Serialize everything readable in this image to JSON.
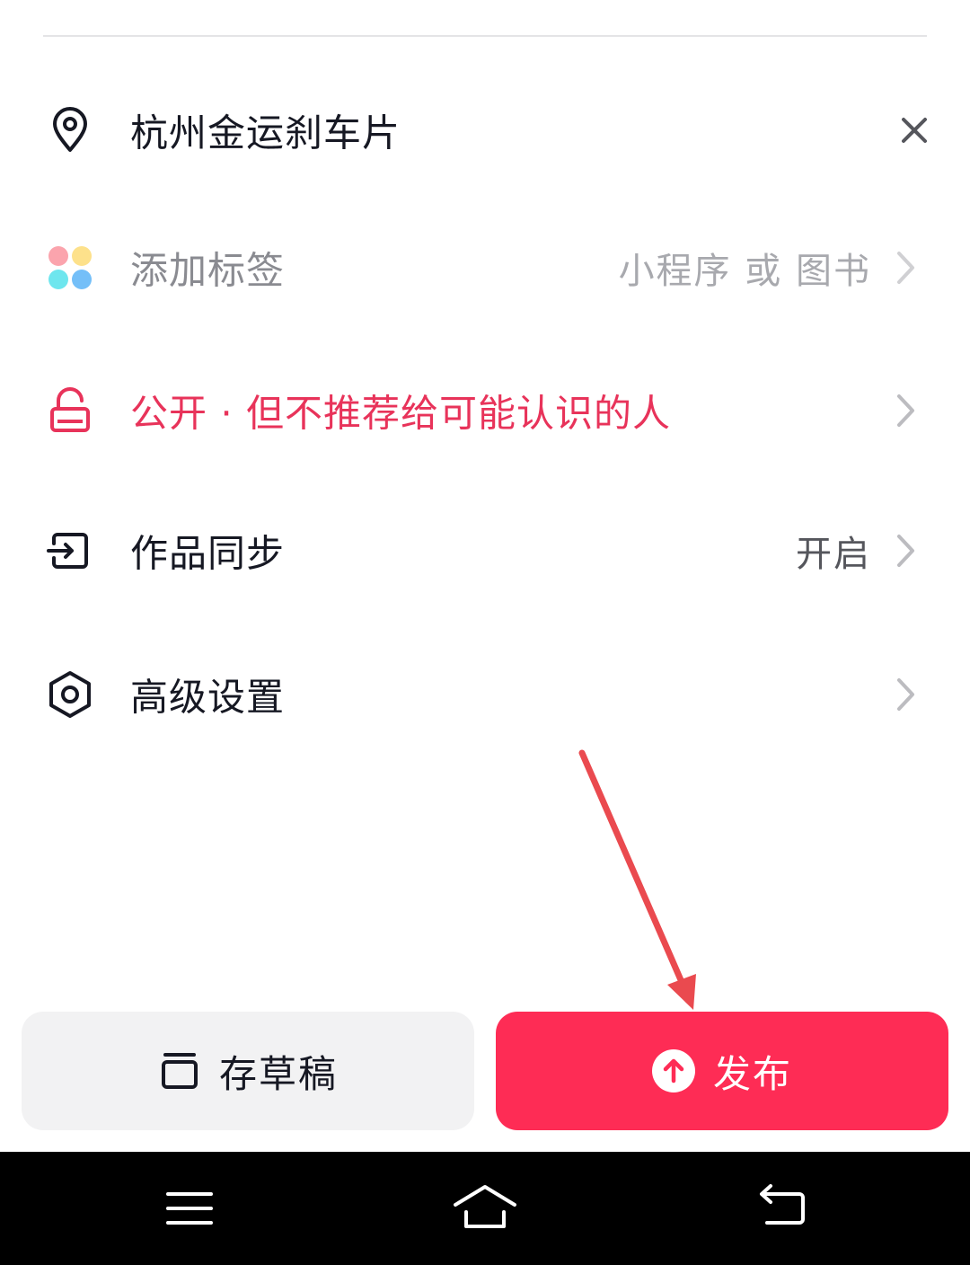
{
  "settings": {
    "location": {
      "label": "杭州金运刹车片",
      "icon": "location-pin-icon",
      "action_icon": "close-icon"
    },
    "tags": {
      "label": "添加标签",
      "value": "小程序 或 图书",
      "icon": "colorful-dots-icon"
    },
    "privacy": {
      "label": "公开 · 但不推荐给可能认识的人",
      "icon": "unlock-icon"
    },
    "sync": {
      "label": "作品同步",
      "value": "开启",
      "icon": "sync-enter-icon"
    },
    "advanced": {
      "label": "高级设置",
      "icon": "hex-settings-icon"
    }
  },
  "actions": {
    "draft_label": "存草稿",
    "publish_label": "发布"
  },
  "colors": {
    "accent": "#fe2c55",
    "privacy_text": "#e8335a",
    "annotation_arrow": "#ea4a4f",
    "navbar": "#000000"
  },
  "navbar": {
    "items": [
      "menu-icon",
      "home-icon",
      "back-icon"
    ]
  }
}
